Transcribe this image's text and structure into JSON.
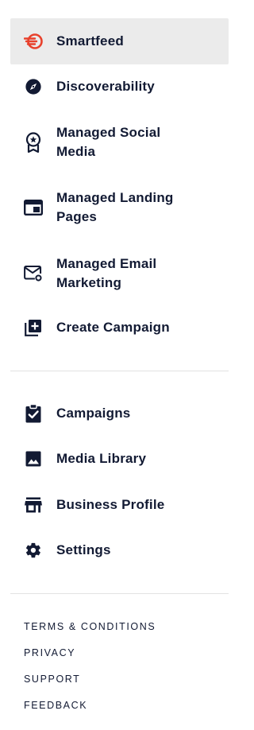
{
  "primary_nav": {
    "items": [
      {
        "label": "Smartfeed",
        "icon": "smartfeed-logo-icon",
        "active": true
      },
      {
        "label": "Discoverability",
        "icon": "compass-icon"
      },
      {
        "label": "Managed Social\nMedia",
        "icon": "award-badge-icon"
      },
      {
        "label": "Managed Landing\nPages",
        "icon": "browser-window-icon"
      },
      {
        "label": "Managed Email\nMarketing",
        "icon": "email-icon"
      },
      {
        "label": "Create Campaign",
        "icon": "add-to-queue-icon"
      }
    ]
  },
  "secondary_nav": {
    "items": [
      {
        "label": "Campaigns",
        "icon": "clipboard-check-icon"
      },
      {
        "label": "Media Library",
        "icon": "image-icon"
      },
      {
        "label": "Business Profile",
        "icon": "storefront-icon"
      },
      {
        "label": "Settings",
        "icon": "gear-icon"
      }
    ]
  },
  "footer": {
    "links": [
      {
        "label": "TERMS & CONDITIONS"
      },
      {
        "label": "PRIVACY"
      },
      {
        "label": "SUPPORT"
      },
      {
        "label": "FEEDBACK"
      }
    ]
  },
  "colors": {
    "text": "#121a33",
    "active_background": "#ebebeb",
    "brand_red": "#e8412c",
    "divider": "#e2e2e2"
  }
}
